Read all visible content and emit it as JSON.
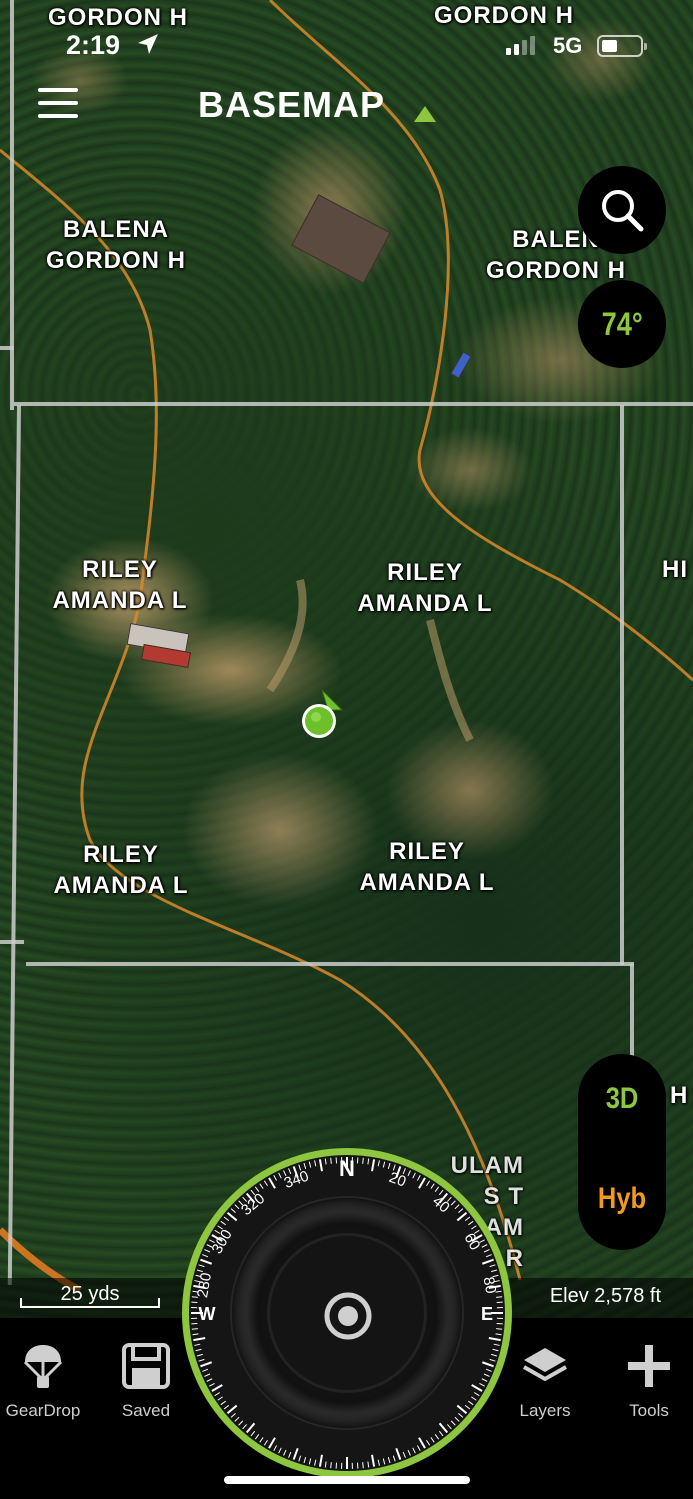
{
  "status_bar": {
    "time": "2:19",
    "network": "5G"
  },
  "header": {
    "app_name": "BASEMAP"
  },
  "map": {
    "labels": [
      "GORDON H",
      "GORDON H",
      "BALENA\nGORDON H",
      "BALEN\nGORDON H",
      "RILEY\nAMANDA L",
      "RILEY\nAMANDA L",
      "RILEY\nAMANDA L",
      "RILEY\nAMANDA L",
      "HI",
      "H",
      "ULAM\nS T\nULAM\nR"
    ],
    "scale_label": "25 yds",
    "elevation": "Elev 2,578 ft"
  },
  "weather": {
    "temperature": "74°"
  },
  "view_toggle": {
    "mode_3d": "3D",
    "map_type": "Hyb"
  },
  "compass": {
    "north": "N",
    "east": "E",
    "west": "W",
    "ticks": [
      "20",
      "40",
      "60",
      "80",
      "280",
      "300",
      "320",
      "340"
    ]
  },
  "tabs": [
    {
      "label": "GearDrop",
      "icon": "parachute-icon"
    },
    {
      "label": "Saved",
      "icon": "save-icon"
    },
    {
      "label": "Layers",
      "icon": "layers-icon"
    },
    {
      "label": "Tools",
      "icon": "plus-icon"
    }
  ],
  "colors": {
    "accent_green": "#8ec63f",
    "temperature": "#8ec63f",
    "hyb": "#f39a1e",
    "boundary_orange": "#d98a2a"
  }
}
